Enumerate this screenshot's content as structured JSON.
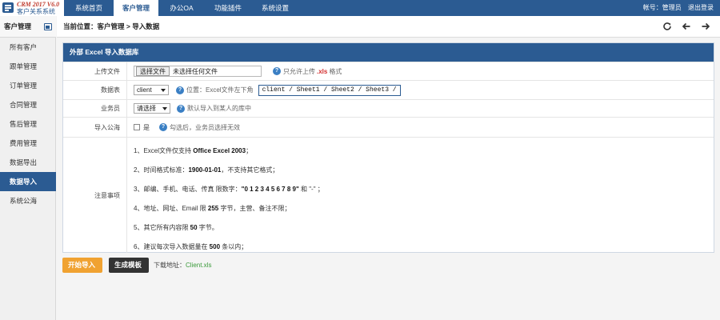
{
  "app": {
    "version": "CRM 2017 V6.0",
    "name": "客户关系系统"
  },
  "nav": [
    {
      "label": "系统首页",
      "active": false
    },
    {
      "label": "客户管理",
      "active": true
    },
    {
      "label": "办公OA",
      "active": false
    },
    {
      "label": "功能插件",
      "active": false
    },
    {
      "label": "系统设置",
      "active": false
    }
  ],
  "account": {
    "label": "帐号：管理员",
    "logout": "退出登录"
  },
  "sidebar": {
    "title": "客户管理",
    "items": [
      {
        "label": "所有客户"
      },
      {
        "label": "跟单管理"
      },
      {
        "label": "订单管理"
      },
      {
        "label": "合同管理"
      },
      {
        "label": "售后管理"
      },
      {
        "label": "费用管理"
      },
      {
        "label": "数据导出"
      },
      {
        "label": "数据导入",
        "active": true
      },
      {
        "label": "系统公海"
      }
    ]
  },
  "breadcrumb": "当前位置：客户管理 > 导入数据",
  "panel": {
    "title": "外部 Excel 导入数据库",
    "upload": {
      "label": "上传文件",
      "button": "选择文件",
      "status": "未选择任何文件",
      "hint_pre": "只允许上传",
      "hint_ext": ".xls",
      "hint_post": "格式"
    },
    "table": {
      "label": "数据表",
      "value": "client",
      "hint": "位置：Excel文件左下角",
      "sheets": "client / Sheet1 / Sheet2 / Sheet3 /"
    },
    "staff": {
      "label": "业务员",
      "value": "请选择",
      "hint": "默认导入到某人的库中"
    },
    "public": {
      "label": "导入公海",
      "checkbox_label": "是",
      "hint": "勾选后，业务员选择无效"
    },
    "notes": {
      "label": "注意事项",
      "items": [
        {
          "pre": "1、Excel文件仅支持 ",
          "bold": "Office Excel 2003",
          "post": "；"
        },
        {
          "pre": "2、时间格式标准：",
          "bold": "1900-01-01",
          "post": "，不支持其它格式；"
        },
        {
          "pre": "3、邮编、手机、电话、传真 限数字：",
          "bold": "\"0 1 2 3 4 5 6 7 8 9\"",
          "post": "  和  \"-\"  ；"
        },
        {
          "pre": "4、地址、网址、Email 限 ",
          "bold": "255",
          "post": " 字节，主营、备注不限；"
        },
        {
          "pre": "5、其它所有内容限 ",
          "bold": "50",
          "post": " 字节。"
        },
        {
          "pre": "6、建议每次导入数据量在 ",
          "red": "500",
          "post": " 条以内；"
        }
      ]
    }
  },
  "buttons": {
    "start": "开始导入",
    "template": "生成模板"
  },
  "download": {
    "label": "下载地址：",
    "file": "Client.xls"
  },
  "colors": {
    "primary": "#2b5b92",
    "accent_orange": "#f0a231",
    "dark_button": "#333333",
    "link_green": "#3a9a3a",
    "warning_red": "#d32f2f"
  },
  "icons": [
    "app-logo-icon",
    "sidebar-toggle-icon",
    "refresh-icon",
    "back-arrow-icon",
    "forward-arrow-icon",
    "help-icon"
  ]
}
